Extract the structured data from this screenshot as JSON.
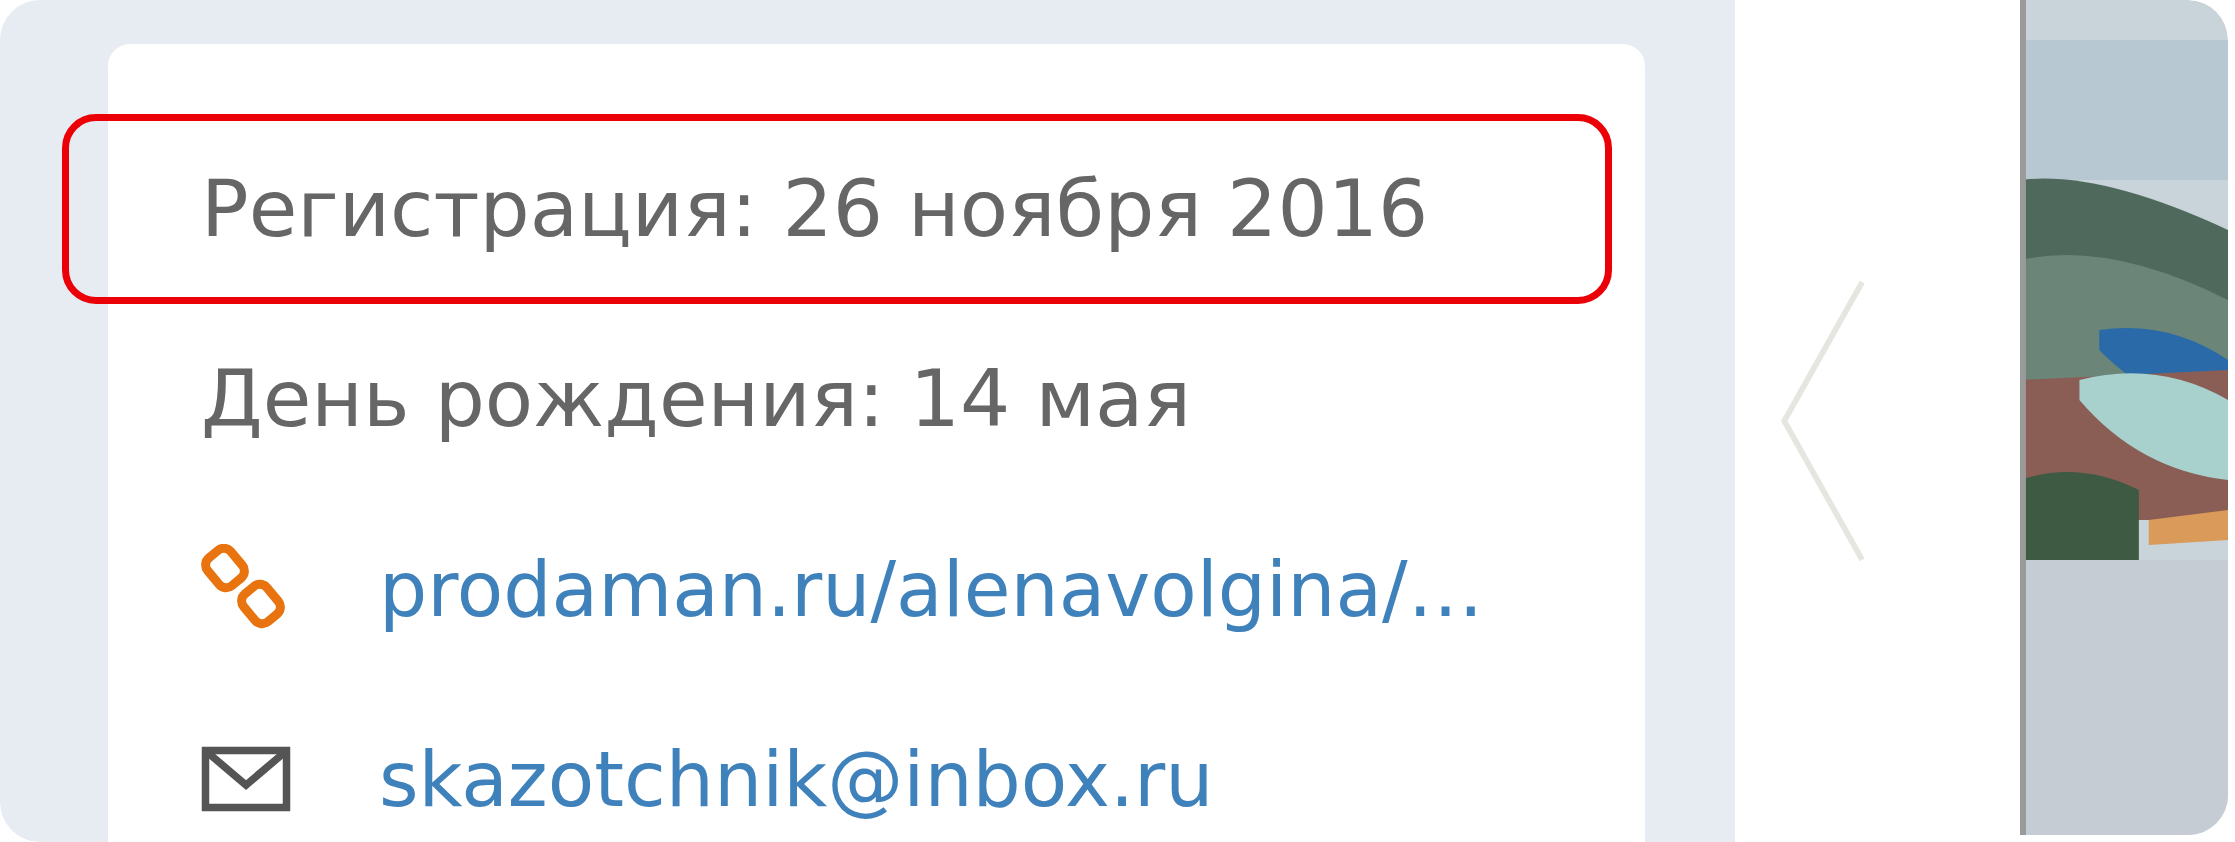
{
  "profile_info": [
    {
      "kind": "text",
      "text": "Регистрация: 26 ноября 2016",
      "highlighted": true
    },
    {
      "kind": "text",
      "text": "День рождения: 14 мая",
      "highlighted": false
    },
    {
      "kind": "link",
      "text": "prodaman.ru/alenavolgina/…",
      "highlighted": false
    },
    {
      "kind": "email",
      "text": "skazotchnik@inbox.ru",
      "highlighted": false
    }
  ]
}
